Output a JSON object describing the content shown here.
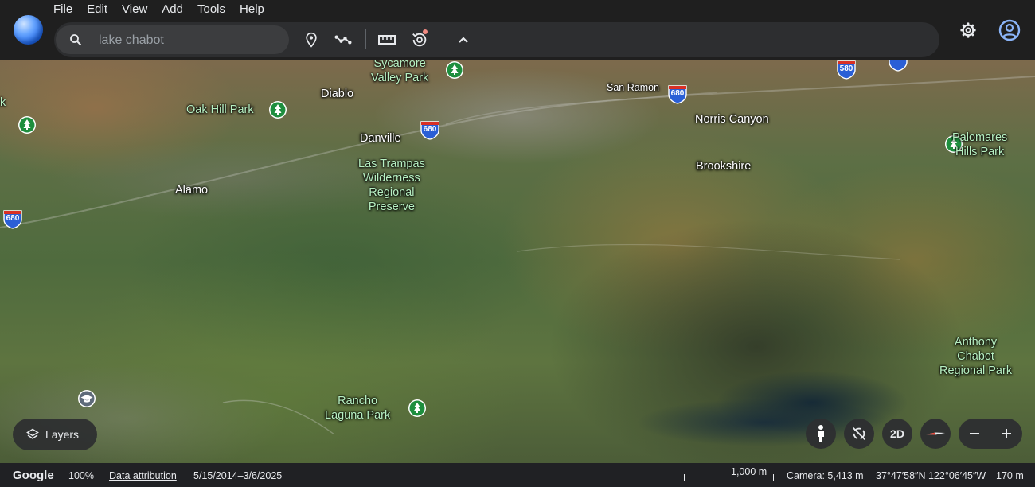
{
  "menu": [
    "File",
    "Edit",
    "View",
    "Add",
    "Tools",
    "Help"
  ],
  "search": {
    "value": "",
    "placeholder": "lake chabot"
  },
  "toolbar": {
    "icons": [
      "place-pin-icon",
      "path-icon",
      "ruler-icon",
      "history-icon",
      "chevron-up-icon"
    ]
  },
  "map": {
    "places": {
      "sycamore": "Sycamore\nValley Park",
      "oak_hill": "Oak Hill Park",
      "diablo": "Diablo",
      "danville": "Danville",
      "san_ramon": "San Ramon",
      "norris_canyon": "Norris Canyon",
      "palomares": "Palomares\nHills Park",
      "las_trampas": "Las Trampas\nWilderness\nRegional\nPreserve",
      "alamo": "Alamo",
      "brookshire": "Brookshire",
      "anthony_chabot": "Anthony\nChabot\nRegional Park",
      "rancho_laguna": "Rancho\nLaguna Park",
      "edge_k": "k"
    },
    "shields": {
      "i680": "680",
      "i580": "580"
    }
  },
  "controls": {
    "layers_label": "Layers",
    "btn_2d": "2D",
    "zoom_out": "−",
    "zoom_in": "+"
  },
  "status": {
    "logo": "Google",
    "zoom": "100%",
    "attribution": "Data attribution",
    "date_range": "5/15/2014–3/6/2025",
    "scale": "1,000 m",
    "camera": "Camera: 5,413 m",
    "coords": "37°47′58″N 122°06′45″W",
    "elevation": "170 m"
  },
  "colors": {
    "accent": "#8ab4f8",
    "park_pin": "#34a853",
    "interstate": "#2a5fd6"
  }
}
